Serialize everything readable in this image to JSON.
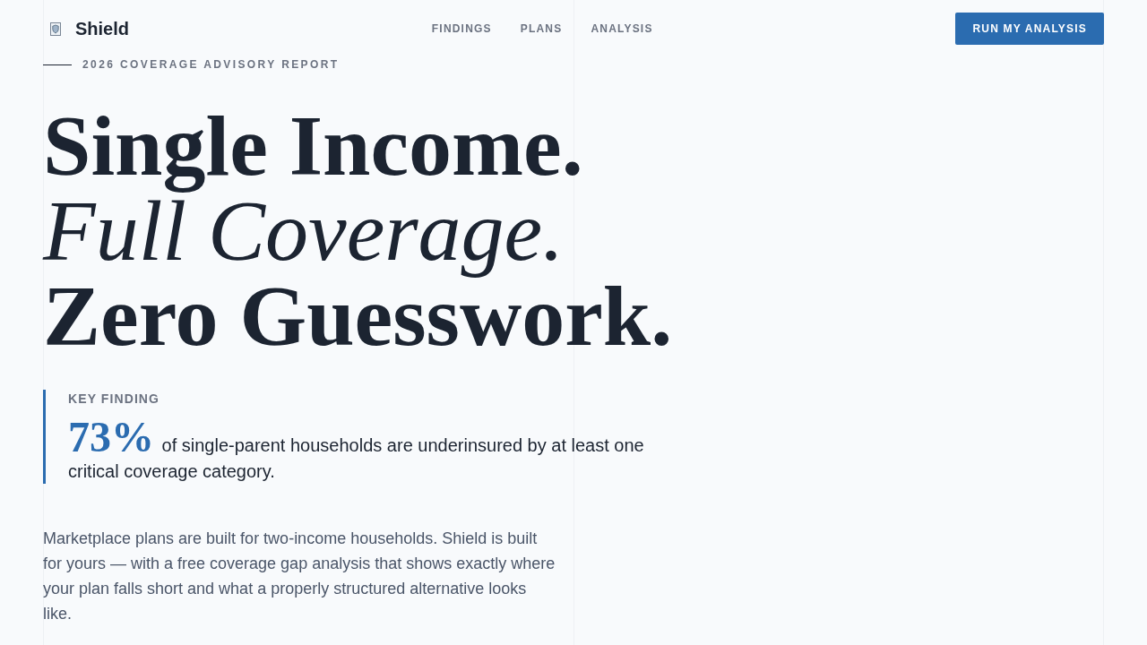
{
  "header": {
    "brand": "Shield",
    "nav": [
      {
        "label": "FINDINGS"
      },
      {
        "label": "PLANS"
      },
      {
        "label": "ANALYSIS"
      }
    ],
    "cta": "RUN MY ANALYSIS"
  },
  "hero": {
    "eyebrow": "2026 COVERAGE ADVISORY REPORT",
    "headline": [
      {
        "text": "Single Income.",
        "kind": "bold"
      },
      {
        "text": "Full Coverage.",
        "kind": "italic"
      },
      {
        "text": "Zero Guesswork.",
        "kind": "bold"
      }
    ],
    "key_finding": {
      "label": "KEY FINDING",
      "stat": "73%",
      "text": "of single-parent households are underinsured by at least one critical coverage category."
    },
    "intro": "Marketplace plans are built for two-income households. Shield is built for yours — with a free coverage gap analysis that shows exactly where your plan falls short and what a properly structured alternative looks like."
  }
}
